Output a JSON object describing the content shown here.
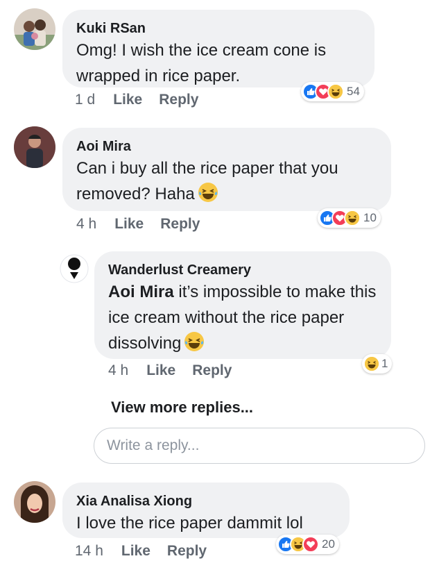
{
  "comments": [
    {
      "author": "Kuki RSan",
      "text": "Omg! I wish the ice cream cone is wrapped in rice paper.",
      "time": "1 d",
      "like_label": "Like",
      "reply_label": "Reply",
      "reactions": [
        "like-icon",
        "love-icon",
        "haha-icon"
      ],
      "reaction_count": "54"
    },
    {
      "author": "Aoi Mira",
      "text": "Can i buy all the rice paper that you removed? Haha",
      "time": "4 h",
      "like_label": "Like",
      "reply_label": "Reply",
      "reactions": [
        "like-icon",
        "love-icon",
        "haha-icon"
      ],
      "reaction_count": "10"
    },
    {
      "author": "Xia Analisa Xiong",
      "text": "I love the rice paper dammit lol",
      "time": "14 h",
      "like_label": "Like",
      "reply_label": "Reply",
      "reactions": [
        "like-icon",
        "haha-icon",
        "love-icon"
      ],
      "reaction_count": "20"
    }
  ],
  "reply": {
    "author": "Wanderlust Creamery",
    "mention": "Aoi Mira",
    "text": " it’s impossible to make this ice cream without the rice paper dissolving",
    "time": "4 h",
    "like_label": "Like",
    "reply_label": "Reply",
    "reactions": [
      "haha-icon"
    ],
    "reaction_count": "1"
  },
  "view_more_label": "View more replies...",
  "reply_input": {
    "placeholder": "Write a reply...",
    "value": ""
  },
  "colors": {
    "like": "#1877f2",
    "love": "#f33e58",
    "haha": "#f7c745",
    "bubble": "#f0f1f3",
    "meta": "#606770"
  }
}
